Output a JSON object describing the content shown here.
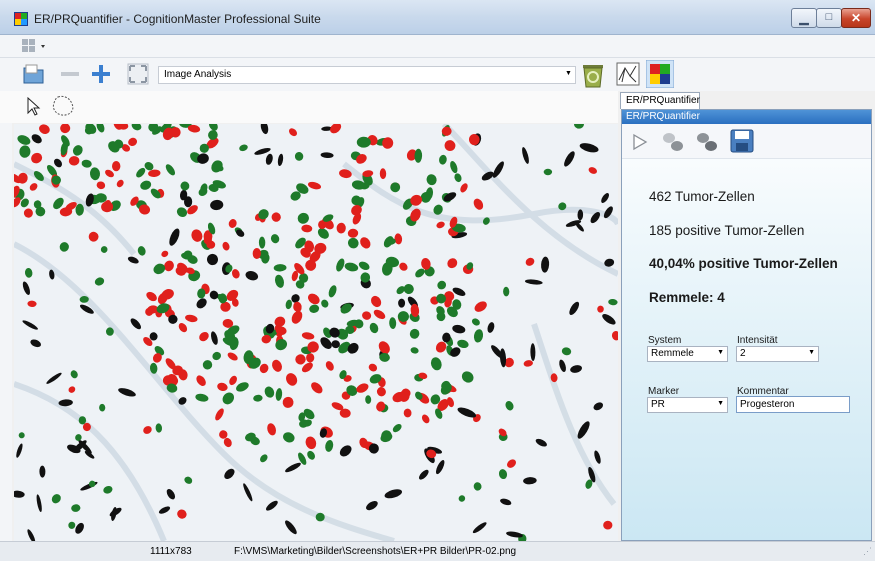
{
  "window": {
    "title": "ER/PRQuantifier - CognitionMaster Professional Suite"
  },
  "toolbar": {
    "analysis_value": "Image Analysis"
  },
  "panel": {
    "tab_label": "ER/PRQuantifier",
    "header_label": "ER/PRQuantifier",
    "stats": {
      "tumor_cells": "462 Tumor-Zellen",
      "positive_cells": "185 positive Tumor-Zellen",
      "percent_positive": "40,04% positive Tumor-Zellen",
      "score": "Remmele: 4"
    },
    "form": {
      "system_label": "System",
      "system_value": "Remmele",
      "intensity_label": "Intensität",
      "intensity_value": "2",
      "marker_label": "Marker",
      "marker_value": "PR",
      "comment_label": "Kommentar",
      "comment_value": "Progesteron"
    }
  },
  "status": {
    "image_size": "1111x783",
    "file_path": "F:\\VMS\\Marketing\\Bilder\\Screenshots\\ER+PR Bilder\\PR-02.png"
  },
  "colors": {
    "positive": "#e0201c",
    "negative": "#1e7a2a",
    "other": "#111111",
    "tissue": "#eef2f6"
  }
}
